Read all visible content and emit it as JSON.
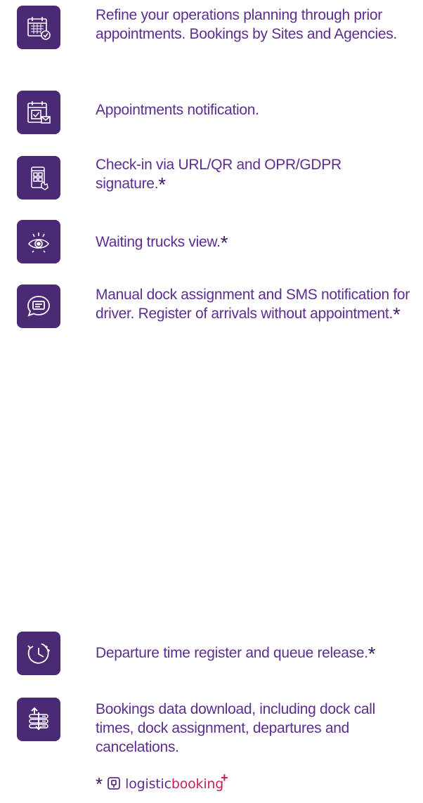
{
  "features": [
    {
      "icon": "calendar-check-icon",
      "text": "Refine your operations planning through prior appointments. Bookings by Sites and Agencies.",
      "asterisk": false
    },
    {
      "icon": "calendar-mail-icon",
      "text": "Appointments notification.",
      "asterisk": false
    },
    {
      "icon": "phone-qr-icon",
      "text": "Check-in via URL/QR and OPR/GDPR signature.",
      "asterisk": true
    },
    {
      "icon": "eye-icon",
      "text": "Waiting trucks view.",
      "asterisk": true
    },
    {
      "icon": "chat-bubble-icon",
      "text": "Manual dock assignment and SMS notification for driver. Register of arrivals without appointment.",
      "asterisk": true
    },
    {
      "icon": "clock-refresh-icon",
      "text": "Departure time register and queue release.",
      "asterisk": true
    },
    {
      "icon": "data-download-icon",
      "text": "Bookings data download, including dock call times, dock assignment, departures and cancelations.",
      "asterisk": false
    }
  ],
  "asterisk_symbol": "*",
  "footer": {
    "asterisk": "*",
    "brand_part1": "logistic",
    "brand_part2": "booking",
    "brand_plus": "+"
  },
  "colors": {
    "icon_bg": "#4a2a73",
    "text": "#5c2e91",
    "asterisk": "#3d1a66",
    "brand_accent": "#c8205a"
  }
}
